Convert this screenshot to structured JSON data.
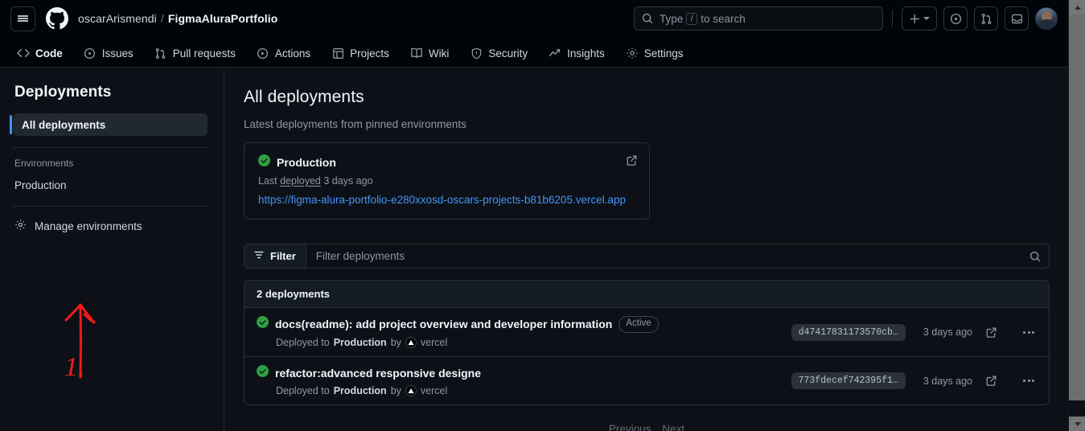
{
  "header": {
    "menu_icon": "hamburger-icon",
    "logo_icon": "github-logo-icon",
    "breadcrumb": {
      "owner": "oscarArismendi",
      "separator": "/",
      "repo": "FigmaAluraPortfolio"
    },
    "search": {
      "placeholder_prefix": "Type",
      "key_hint": "/",
      "placeholder_suffix": "to search",
      "icon": "search-icon"
    },
    "actions": [
      {
        "name": "create-new-button",
        "icon": "plus-icon",
        "caret": true
      },
      {
        "name": "issues-button",
        "icon": "issue-opened-icon"
      },
      {
        "name": "pull-requests-button",
        "icon": "git-pull-request-icon"
      },
      {
        "name": "inbox-button",
        "icon": "inbox-icon"
      }
    ],
    "avatar": "user-avatar"
  },
  "nav": {
    "tabs": [
      {
        "label": "Code",
        "icon": "code-icon",
        "active": true
      },
      {
        "label": "Issues",
        "icon": "issue-opened-icon",
        "active": false
      },
      {
        "label": "Pull requests",
        "icon": "git-pull-request-icon",
        "active": false
      },
      {
        "label": "Actions",
        "icon": "play-icon",
        "active": false
      },
      {
        "label": "Projects",
        "icon": "table-icon",
        "active": false
      },
      {
        "label": "Wiki",
        "icon": "book-icon",
        "active": false
      },
      {
        "label": "Security",
        "icon": "shield-icon",
        "active": false
      },
      {
        "label": "Insights",
        "icon": "graph-icon",
        "active": false
      },
      {
        "label": "Settings",
        "icon": "gear-icon",
        "active": false
      }
    ]
  },
  "sidebar": {
    "title": "Deployments",
    "active_item": "All deployments",
    "section_label": "Environments",
    "environment": "Production",
    "manage": {
      "label": "Manage environments",
      "icon": "gear-icon"
    }
  },
  "annotation": {
    "number": "1.",
    "shape": "up-arrow",
    "color": "#f51919"
  },
  "main": {
    "heading": "All deployments",
    "subheading": "Latest deployments from pinned environments",
    "production_card": {
      "status_icon": "check-circle-icon",
      "status_color": "#2ea043",
      "name": "Production",
      "last_prefix": "Last",
      "last_link": "deployed",
      "last_time": "3 days ago",
      "url": "https://figma-alura-portfolio-e280xxosd-oscars-projects-b81b6205.vercel.app",
      "external_icon": "external-link-icon"
    },
    "filter": {
      "button_label": "Filter",
      "button_icon": "filter-icon",
      "placeholder": "Filter deployments",
      "search_icon": "search-icon"
    },
    "list": {
      "count_label": "2 deployments",
      "rows": [
        {
          "status_icon": "check-circle-icon",
          "title": "docs(readme): add project overview and developer information",
          "badge": "Active",
          "sub_prefix": "Deployed to",
          "environment": "Production",
          "sub_by": "by",
          "actor_icon": "vercel-icon",
          "actor": "vercel",
          "sha": "d47417831173570cb…",
          "time": "3 days ago",
          "external_icon": "external-link-icon",
          "menu_icon": "kebab-horizontal-icon"
        },
        {
          "status_icon": "check-circle-icon",
          "title": "refactor:advanced responsive designe",
          "badge": "",
          "sub_prefix": "Deployed to",
          "environment": "Production",
          "sub_by": "by",
          "actor_icon": "vercel-icon",
          "actor": "vercel",
          "sha": "773fdecef742395f1…",
          "time": "3 days ago",
          "external_icon": "external-link-icon",
          "menu_icon": "kebab-horizontal-icon"
        }
      ]
    },
    "pagination": {
      "previous": "Previous",
      "next": "Next"
    }
  },
  "colors": {
    "accent_blue": "#4493f8",
    "success_green": "#2ea043",
    "active_tab_underline": "#f78166",
    "page_bg": "#0d1117",
    "header_bg": "#010409"
  }
}
